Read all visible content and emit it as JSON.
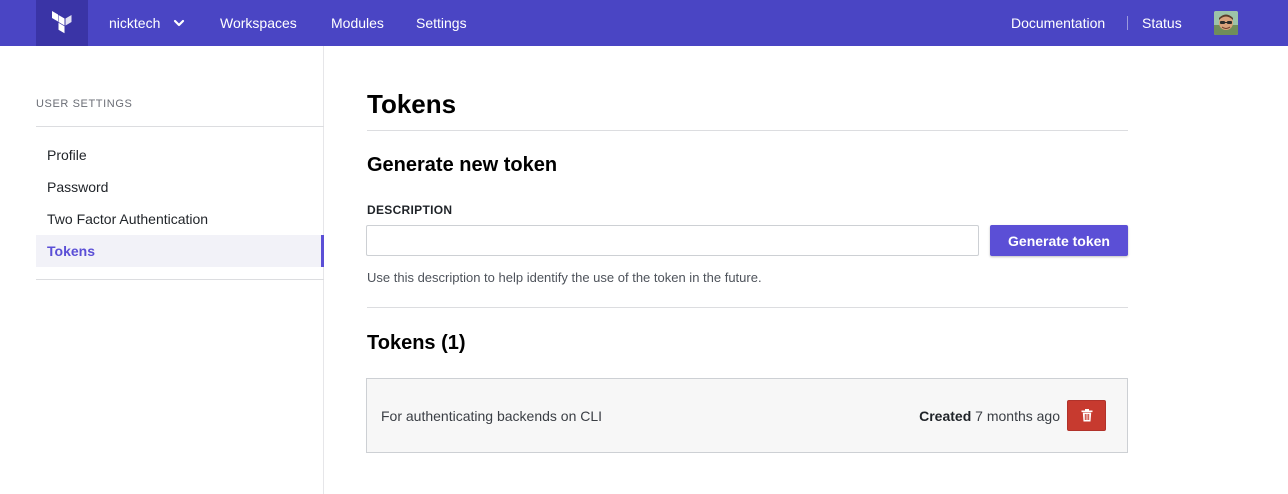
{
  "nav": {
    "org_name": "nicktech",
    "links": [
      "Workspaces",
      "Modules",
      "Settings"
    ],
    "right_links": [
      "Documentation",
      "Status"
    ],
    "brand_color": "#4a45c4"
  },
  "sidebar": {
    "heading": "USER SETTINGS",
    "items": [
      {
        "label": "Profile",
        "active": false
      },
      {
        "label": "Password",
        "active": false
      },
      {
        "label": "Two Factor Authentication",
        "active": false
      },
      {
        "label": "Tokens",
        "active": true
      }
    ]
  },
  "main": {
    "title": "Tokens",
    "generate": {
      "heading": "Generate new token",
      "field_label": "DESCRIPTION",
      "input_value": "",
      "button_label": "Generate token",
      "help_text": "Use this description to help identify the use of the token in the future."
    },
    "tokens": {
      "heading": "Tokens (1)",
      "items": [
        {
          "description": "For authenticating backends on CLI",
          "created_label": "Created",
          "created_value": "7 months ago",
          "delete_icon": "trash-icon"
        }
      ]
    }
  },
  "colors": {
    "accent": "#5b4fd6",
    "danger": "#c73a2f"
  }
}
